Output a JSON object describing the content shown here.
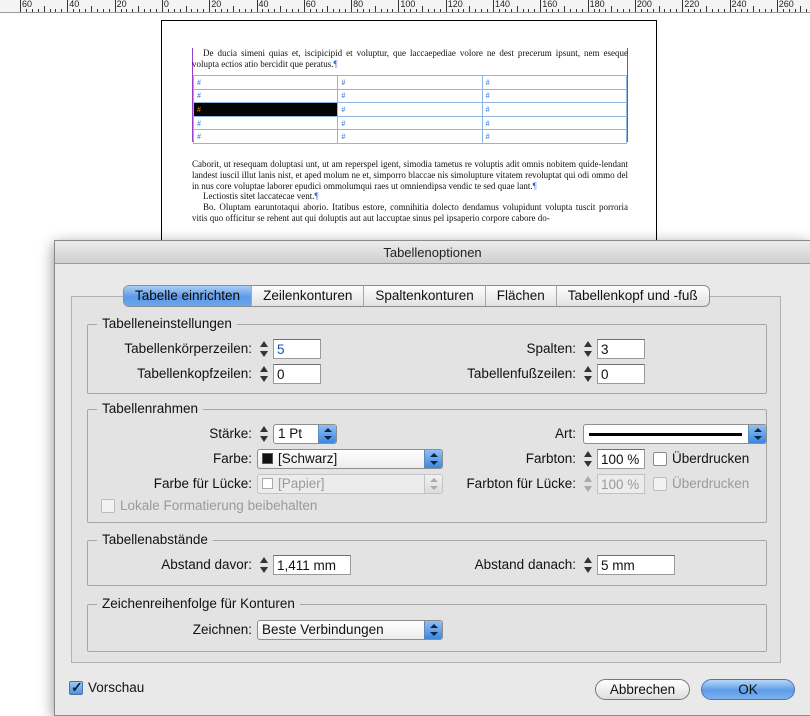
{
  "ruler": {
    "labels": [
      "60",
      "40",
      "20",
      "0",
      "20",
      "40",
      "60",
      "80",
      "100",
      "120",
      "140",
      "160",
      "180",
      "200",
      "220",
      "240",
      "260"
    ]
  },
  "document": {
    "para1": "De ducia simeni quias et, iscipicipid et voluptur, que laccaepediae volore ne dest precerum ipsunt, nem eseque volupta ectios atio bercidit que peratus.",
    "table_marker": "#",
    "para2": "Caborit, ut resequam doluptasi unt, ut am reperspel igent, simodia tametus re voluptis adit omnis nobitem quide-lendant landest iuscil illut lanis nist, et aped molum ne et, simporro blaccae nis simolupture vitatem revoluptat qui odi ommo del in nus core voluptae laborer epudici ommolumqui raes ut omniendipsa vendic te sed quae lant.",
    "para3": "Lectiostis sitet laccatecae vent.",
    "para4": "Bo. Oluptam earuntotaqui aborio. Itatibus estore, comnihitia dolecto dendamus volupidunt volupta tuscit porroria vitis quo officitur se rehent aut qui doluptis aut aut laccuptae sinus pel ipsaperio corpore cabore do-",
    "pilcrow": "¶"
  },
  "dialog": {
    "title": "Tabellenoptionen",
    "tabs": [
      {
        "label": "Tabelle einrichten",
        "active": true
      },
      {
        "label": "Zeilenkonturen",
        "active": false
      },
      {
        "label": "Spaltenkonturen",
        "active": false
      },
      {
        "label": "Flächen",
        "active": false
      },
      {
        "label": "Tabellenkopf und -fuß",
        "active": false
      }
    ],
    "settings": {
      "title": "Tabelleneinstellungen",
      "body_rows_label": "Tabellenkörperzeilen:",
      "body_rows_value": "5",
      "columns_label": "Spalten:",
      "columns_value": "3",
      "header_rows_label": "Tabellenkopfzeilen:",
      "header_rows_value": "0",
      "footer_rows_label": "Tabellenfußzeilen:",
      "footer_rows_value": "0"
    },
    "border": {
      "title": "Tabellenrahmen",
      "weight_label": "Stärke:",
      "weight_value": "1 Pt",
      "type_label": "Art:",
      "color_label": "Farbe:",
      "color_value": "[Schwarz]",
      "color_swatch": "#111111",
      "tint_label": "Farbton:",
      "tint_value": "100 %",
      "overprint_label": "Überdrucken",
      "gap_color_label": "Farbe für Lücke:",
      "gap_color_value": "[Papier]",
      "gap_tint_label": "Farbton für Lücke:",
      "gap_tint_value": "100 %",
      "gap_overprint_label": "Überdrucken",
      "preserve_label": "Lokale Formatierung beibehalten"
    },
    "spacing": {
      "title": "Tabellenabstände",
      "before_label": "Abstand davor:",
      "before_value": "1,411 mm",
      "after_label": "Abstand danach:",
      "after_value": "5 mm"
    },
    "stroke_order": {
      "title": "Zeichenreihenfolge für Konturen",
      "draw_label": "Zeichnen:",
      "draw_value": "Beste Verbindungen"
    },
    "preview_label": "Vorschau",
    "preview_checked": true,
    "cancel_label": "Abbrechen",
    "ok_label": "OK"
  },
  "colors": {
    "accent": "#5c9ae6",
    "frame": "#9b3cc6",
    "table_grid": "#8db7e0"
  }
}
